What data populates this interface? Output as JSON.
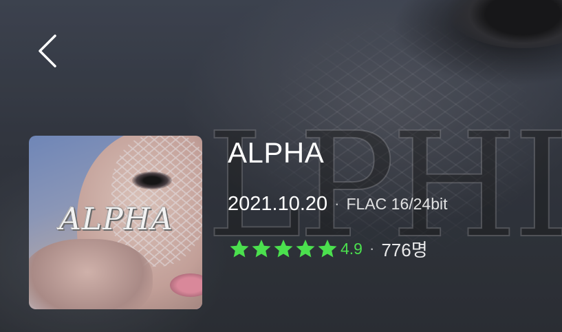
{
  "header": {
    "back_icon": "chevron-left-icon"
  },
  "album": {
    "cover_title": "ALPHA",
    "title": "ALPHA",
    "release_date": "2021.10.20",
    "separator": "·",
    "format": "FLAC 16/24bit",
    "rating": {
      "stars": 5,
      "star_icon": "star-icon",
      "value": "4.9",
      "count": "776명"
    }
  },
  "colors": {
    "rating_accent": "#4be04e",
    "text_primary": "#ffffff"
  }
}
